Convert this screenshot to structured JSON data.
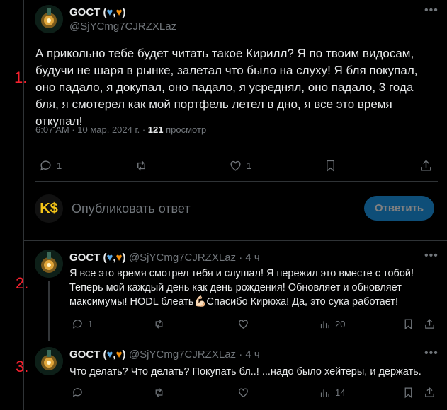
{
  "labels": {
    "n1": "1.",
    "n2": "2.",
    "n3": "3."
  },
  "main_tweet": {
    "author_name": "GOCT (",
    "author_name_end": ")",
    "handle": "@SjYCmg7CJRZXLaz",
    "text": "А прикольно тебе будет читать такое Кирилл? Я по твоим видосам, будучи не шаря в рынке, залетал что было на слуху! Я бля покупал, оно падало, я докупал, оно падало, я усреднял, оно падало, 3 года бля, я смотерел как мой портфель летел в дно, я все это время откупал!",
    "time": "6:07 AM · 10 мар. 2024 г. · ",
    "views_count": "121",
    "views_label": " просмотр",
    "replies": "1",
    "likes": "1"
  },
  "composer": {
    "avatar_text": "K$",
    "placeholder": "Опубликовать ответ",
    "button": "Ответить"
  },
  "reply1": {
    "author_name": "GOCT (",
    "author_name_end": ")",
    "handle": "@SjYCmg7CJRZXLaz · 4 ч",
    "text": "Я все это время смотрел тебя и слушал! Я пережил это вместе с тобой! Теперь мой каждый день как день рождения! Обновляет и обновляет максимумы! HODL блеать💪🏻Спасибо Кирюха! Да, это сука работает!",
    "replies": "1",
    "views": "20"
  },
  "reply2": {
    "author_name": "GOCT (",
    "author_name_end": ")",
    "handle": "@SjYCmg7CJRZXLaz · 4 ч",
    "text": "Что делать? Что делать? Покупать бл..! ...надо было хейтеры, и держать.",
    "views": "14"
  },
  "colors": {
    "accent": "#1d9bf0",
    "heart_blue": "#5aa9e6",
    "heart_orange": "#f4900c",
    "gold": "#f5c518"
  }
}
